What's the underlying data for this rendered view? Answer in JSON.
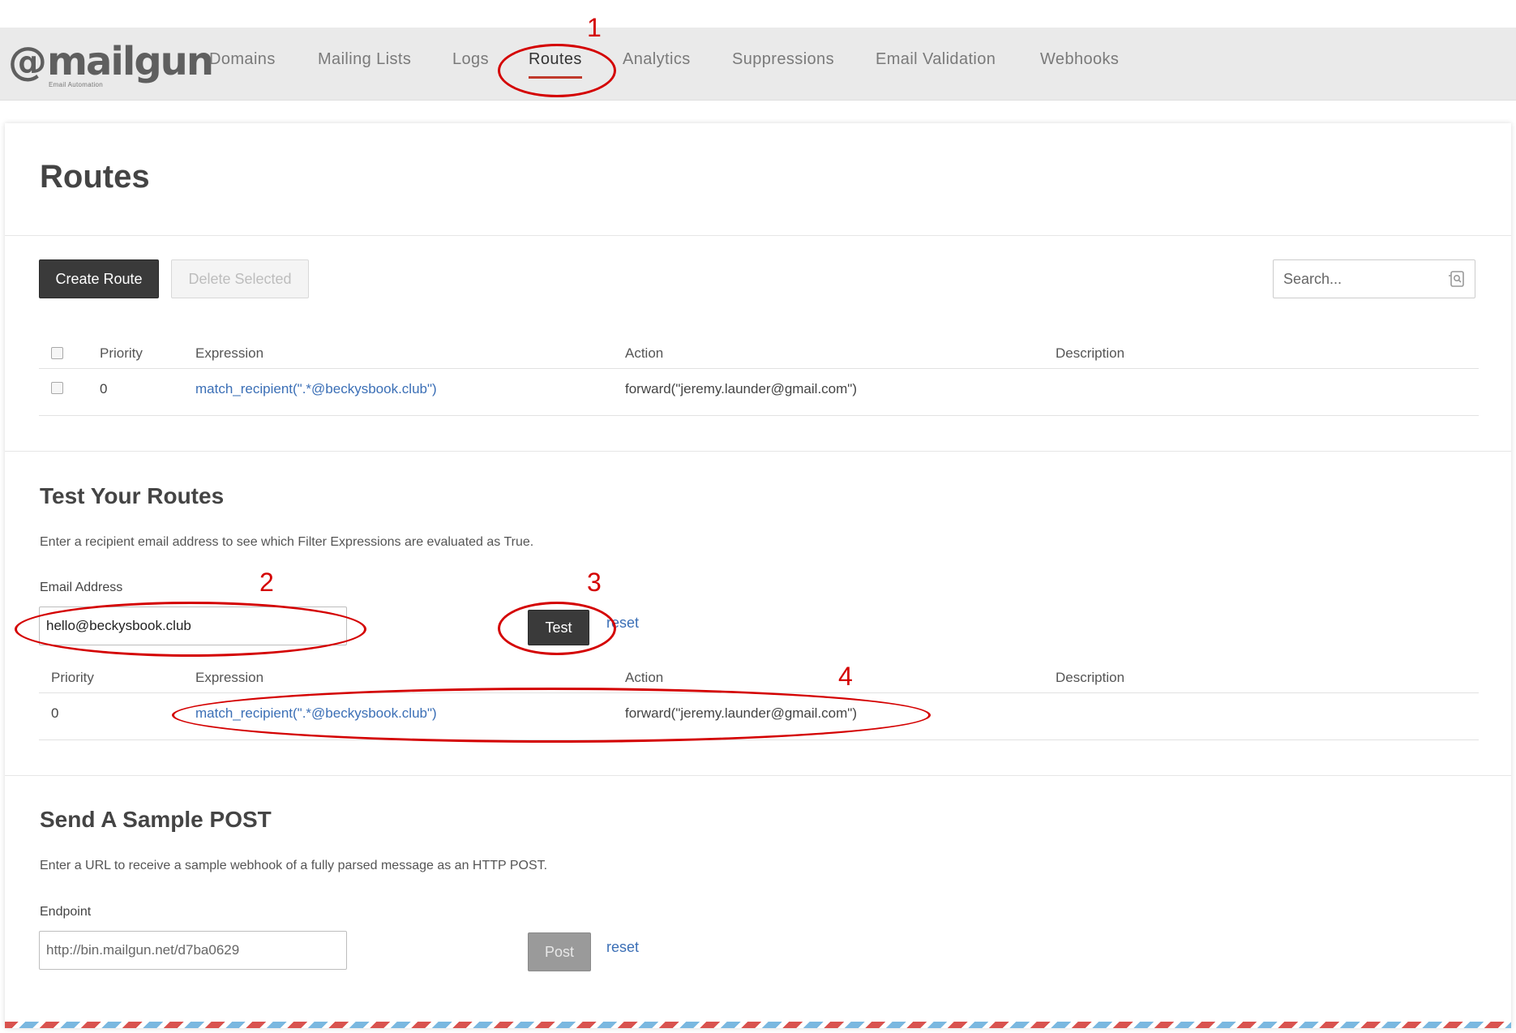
{
  "logo": {
    "word": "mailgun",
    "sub": "Email Automation"
  },
  "nav": {
    "items": [
      {
        "label": "Domains"
      },
      {
        "label": "Mailing Lists"
      },
      {
        "label": "Logs"
      },
      {
        "label": "Routes",
        "active": true
      },
      {
        "label": "Analytics"
      },
      {
        "label": "Suppressions"
      },
      {
        "label": "Email Validation"
      },
      {
        "label": "Webhooks"
      }
    ]
  },
  "page": {
    "title": "Routes"
  },
  "toolbar": {
    "create_label": "Create Route",
    "delete_label": "Delete Selected",
    "search_placeholder": "Search..."
  },
  "routes_table": {
    "headers": {
      "priority": "Priority",
      "expression": "Expression",
      "action": "Action",
      "description": "Description"
    },
    "rows": [
      {
        "priority": "0",
        "expression": "match_recipient(\".*@beckysbook.club\")",
        "action": "forward(\"jeremy.launder@gmail.com\")",
        "description": ""
      }
    ]
  },
  "test_section": {
    "title": "Test Your Routes",
    "description": "Enter a recipient email address to see which Filter Expressions are evaluated as True.",
    "field_label": "Email Address",
    "field_value": "hello@beckysbook.club",
    "test_label": "Test",
    "reset_label": "reset",
    "headers": {
      "priority": "Priority",
      "expression": "Expression",
      "action": "Action",
      "description": "Description"
    },
    "rows": [
      {
        "priority": "0",
        "expression": "match_recipient(\".*@beckysbook.club\")",
        "action": "forward(\"jeremy.launder@gmail.com\")",
        "description": ""
      }
    ]
  },
  "post_section": {
    "title": "Send A Sample POST",
    "description": "Enter a URL to receive a sample webhook of a fully parsed message as an HTTP POST.",
    "field_label": "Endpoint",
    "field_value": "http://bin.mailgun.net/d7ba0629",
    "post_label": "Post",
    "reset_label": "reset"
  },
  "annotations": [
    "1",
    "2",
    "3",
    "4"
  ],
  "colors": {
    "annotation": "#d40000",
    "link": "#3b6fb6",
    "nav_active_underline": "#c0392b",
    "dark_button": "#3a3a3a"
  }
}
